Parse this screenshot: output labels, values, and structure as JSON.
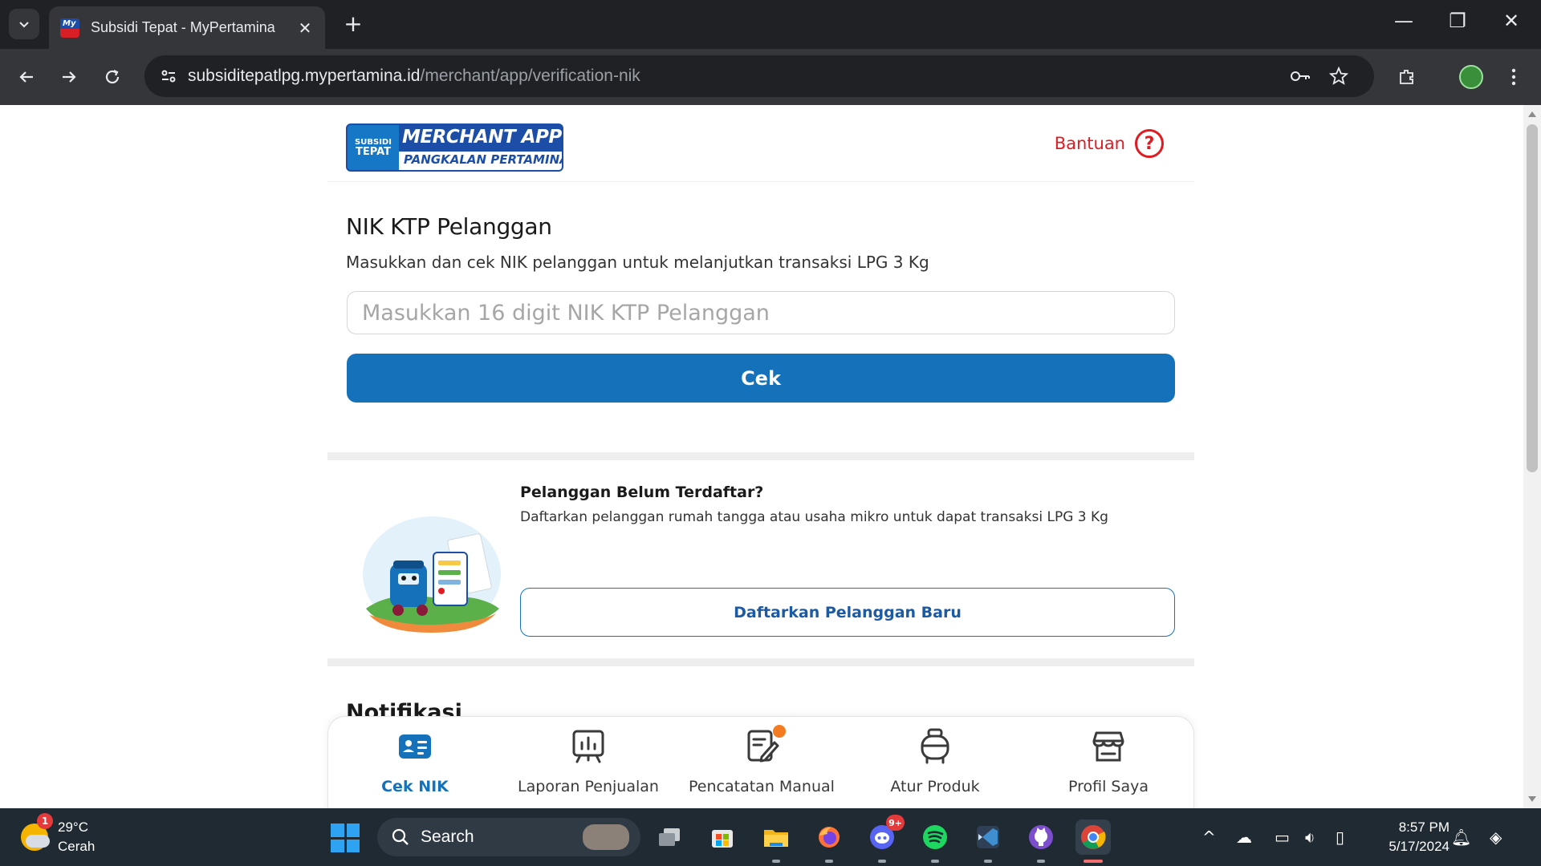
{
  "browser": {
    "tab_title": "Subsidi Tepat - MyPertamina",
    "favicon_text": "My",
    "url_host": "subsiditepatlpg.mypertamina.id",
    "url_path": "/merchant/app/verification-nik"
  },
  "header": {
    "logo_badge_top": "SUBSIDI",
    "logo_badge_bottom": "TEPAT",
    "logo_title": "MERCHANT APPS",
    "logo_subtitle": "PANGKALAN PERTAMINA",
    "help_label": "Bantuan"
  },
  "nik_section": {
    "title": "NIK KTP Pelanggan",
    "subtitle": "Masukkan dan cek NIK pelanggan untuk melanjutkan transaksi LPG 3 Kg",
    "input_placeholder": "Masukkan 16 digit NIK KTP Pelanggan",
    "input_value": "",
    "button_label": "Cek"
  },
  "register_section": {
    "title": "Pelanggan Belum Terdaftar?",
    "subtitle": "Daftarkan pelanggan rumah tangga atau usaha mikro untuk dapat transaksi LPG 3 Kg",
    "button_label": "Daftarkan Pelanggan Baru"
  },
  "notifications": {
    "title": "Notifikasi"
  },
  "bottom_nav": {
    "items": [
      {
        "label": "Cek NIK",
        "icon": "id-card-icon",
        "active": true
      },
      {
        "label": "Laporan Penjualan",
        "icon": "chart-board-icon",
        "active": false
      },
      {
        "label": "Pencatatan Manual",
        "icon": "edit-document-icon",
        "active": false
      },
      {
        "label": "Atur Produk",
        "icon": "gas-cylinder-icon",
        "active": false
      },
      {
        "label": "Profil Saya",
        "icon": "store-icon",
        "active": false
      }
    ]
  },
  "taskbar": {
    "weather_temp": "29°C",
    "weather_desc": "Cerah",
    "weather_badge": "1",
    "search_label": "Search",
    "discord_badge": "9+",
    "time": "8:57 PM",
    "date": "5/17/2024"
  },
  "colors": {
    "primary_blue": "#1572ba",
    "brand_red": "#e11b22",
    "brand_navy": "#1c4ea7",
    "notification_orange": "#f47b20"
  }
}
